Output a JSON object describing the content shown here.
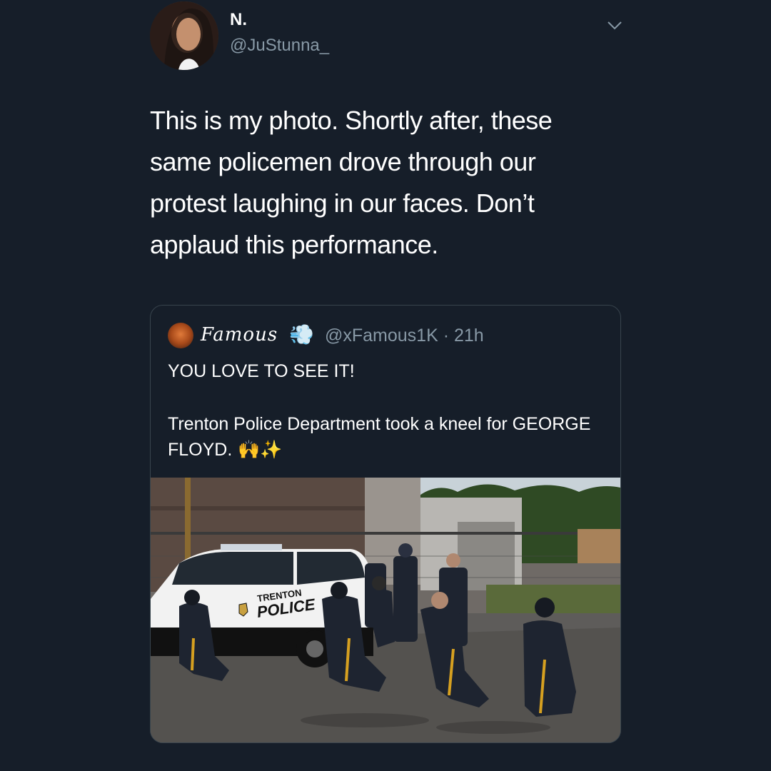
{
  "tweet": {
    "author_name": "N.",
    "author_handle": "@JuStunna_",
    "text": "This is my photo. Shortly after, these same policemen drove through our protest laughing in our faces. Don’t applaud this performance."
  },
  "quoted_tweet": {
    "author_name": "Famous",
    "name_emoji": "💨",
    "meta": "@xFamous1K · 21h",
    "line1": "YOU LOVE TO SEE IT!",
    "body": "Trenton Police Department  took a kneel for GEORGE FLOYD.",
    "emojis": "🙌✨",
    "photo": {
      "vehicle_text_top": "TRENTON",
      "vehicle_text_bottom": "POLICE"
    }
  },
  "icons": {
    "menu": "chevron-down-icon"
  },
  "colors": {
    "background": "#161e29",
    "secondary_text": "#8899a6",
    "border": "#38444d"
  }
}
